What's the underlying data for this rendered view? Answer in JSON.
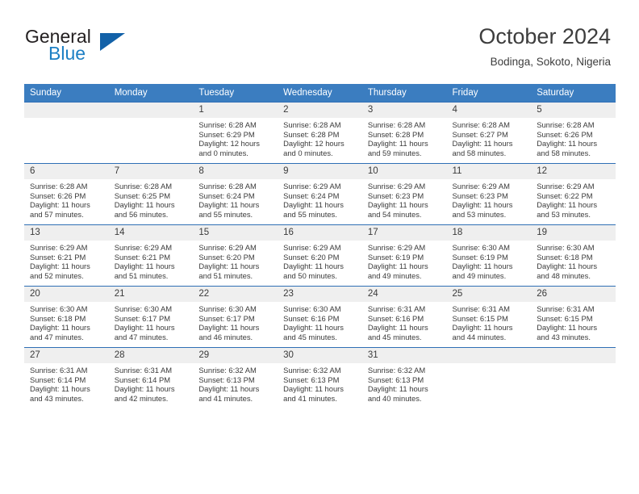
{
  "brand": {
    "name_part1": "General",
    "name_part2": "Blue",
    "logo_icon": "triangle-logo-icon"
  },
  "header": {
    "month_title": "October 2024",
    "location": "Bodinga, Sokoto, Nigeria"
  },
  "colors": {
    "header_blue": "#3b7dc0",
    "row_border_blue": "#2f6fb5",
    "daynum_band": "#efefef",
    "brand_blue": "#1c7fc4",
    "logo_blue": "#1261a8"
  },
  "calendar": {
    "weekday_headers": [
      "Sunday",
      "Monday",
      "Tuesday",
      "Wednesday",
      "Thursday",
      "Friday",
      "Saturday"
    ],
    "labels": {
      "sunrise": "Sunrise:",
      "sunset": "Sunset:",
      "daylight": "Daylight:"
    },
    "weeks": [
      [
        {
          "day": "",
          "empty": true
        },
        {
          "day": "",
          "empty": true
        },
        {
          "day": "1",
          "sunrise": "Sunrise: 6:28 AM",
          "sunset": "Sunset: 6:29 PM",
          "daylight": "Daylight: 12 hours and 0 minutes."
        },
        {
          "day": "2",
          "sunrise": "Sunrise: 6:28 AM",
          "sunset": "Sunset: 6:28 PM",
          "daylight": "Daylight: 12 hours and 0 minutes."
        },
        {
          "day": "3",
          "sunrise": "Sunrise: 6:28 AM",
          "sunset": "Sunset: 6:28 PM",
          "daylight": "Daylight: 11 hours and 59 minutes."
        },
        {
          "day": "4",
          "sunrise": "Sunrise: 6:28 AM",
          "sunset": "Sunset: 6:27 PM",
          "daylight": "Daylight: 11 hours and 58 minutes."
        },
        {
          "day": "5",
          "sunrise": "Sunrise: 6:28 AM",
          "sunset": "Sunset: 6:26 PM",
          "daylight": "Daylight: 11 hours and 58 minutes."
        }
      ],
      [
        {
          "day": "6",
          "sunrise": "Sunrise: 6:28 AM",
          "sunset": "Sunset: 6:26 PM",
          "daylight": "Daylight: 11 hours and 57 minutes."
        },
        {
          "day": "7",
          "sunrise": "Sunrise: 6:28 AM",
          "sunset": "Sunset: 6:25 PM",
          "daylight": "Daylight: 11 hours and 56 minutes."
        },
        {
          "day": "8",
          "sunrise": "Sunrise: 6:28 AM",
          "sunset": "Sunset: 6:24 PM",
          "daylight": "Daylight: 11 hours and 55 minutes."
        },
        {
          "day": "9",
          "sunrise": "Sunrise: 6:29 AM",
          "sunset": "Sunset: 6:24 PM",
          "daylight": "Daylight: 11 hours and 55 minutes."
        },
        {
          "day": "10",
          "sunrise": "Sunrise: 6:29 AM",
          "sunset": "Sunset: 6:23 PM",
          "daylight": "Daylight: 11 hours and 54 minutes."
        },
        {
          "day": "11",
          "sunrise": "Sunrise: 6:29 AM",
          "sunset": "Sunset: 6:23 PM",
          "daylight": "Daylight: 11 hours and 53 minutes."
        },
        {
          "day": "12",
          "sunrise": "Sunrise: 6:29 AM",
          "sunset": "Sunset: 6:22 PM",
          "daylight": "Daylight: 11 hours and 53 minutes."
        }
      ],
      [
        {
          "day": "13",
          "sunrise": "Sunrise: 6:29 AM",
          "sunset": "Sunset: 6:21 PM",
          "daylight": "Daylight: 11 hours and 52 minutes."
        },
        {
          "day": "14",
          "sunrise": "Sunrise: 6:29 AM",
          "sunset": "Sunset: 6:21 PM",
          "daylight": "Daylight: 11 hours and 51 minutes."
        },
        {
          "day": "15",
          "sunrise": "Sunrise: 6:29 AM",
          "sunset": "Sunset: 6:20 PM",
          "daylight": "Daylight: 11 hours and 51 minutes."
        },
        {
          "day": "16",
          "sunrise": "Sunrise: 6:29 AM",
          "sunset": "Sunset: 6:20 PM",
          "daylight": "Daylight: 11 hours and 50 minutes."
        },
        {
          "day": "17",
          "sunrise": "Sunrise: 6:29 AM",
          "sunset": "Sunset: 6:19 PM",
          "daylight": "Daylight: 11 hours and 49 minutes."
        },
        {
          "day": "18",
          "sunrise": "Sunrise: 6:30 AM",
          "sunset": "Sunset: 6:19 PM",
          "daylight": "Daylight: 11 hours and 49 minutes."
        },
        {
          "day": "19",
          "sunrise": "Sunrise: 6:30 AM",
          "sunset": "Sunset: 6:18 PM",
          "daylight": "Daylight: 11 hours and 48 minutes."
        }
      ],
      [
        {
          "day": "20",
          "sunrise": "Sunrise: 6:30 AM",
          "sunset": "Sunset: 6:18 PM",
          "daylight": "Daylight: 11 hours and 47 minutes."
        },
        {
          "day": "21",
          "sunrise": "Sunrise: 6:30 AM",
          "sunset": "Sunset: 6:17 PM",
          "daylight": "Daylight: 11 hours and 47 minutes."
        },
        {
          "day": "22",
          "sunrise": "Sunrise: 6:30 AM",
          "sunset": "Sunset: 6:17 PM",
          "daylight": "Daylight: 11 hours and 46 minutes."
        },
        {
          "day": "23",
          "sunrise": "Sunrise: 6:30 AM",
          "sunset": "Sunset: 6:16 PM",
          "daylight": "Daylight: 11 hours and 45 minutes."
        },
        {
          "day": "24",
          "sunrise": "Sunrise: 6:31 AM",
          "sunset": "Sunset: 6:16 PM",
          "daylight": "Daylight: 11 hours and 45 minutes."
        },
        {
          "day": "25",
          "sunrise": "Sunrise: 6:31 AM",
          "sunset": "Sunset: 6:15 PM",
          "daylight": "Daylight: 11 hours and 44 minutes."
        },
        {
          "day": "26",
          "sunrise": "Sunrise: 6:31 AM",
          "sunset": "Sunset: 6:15 PM",
          "daylight": "Daylight: 11 hours and 43 minutes."
        }
      ],
      [
        {
          "day": "27",
          "sunrise": "Sunrise: 6:31 AM",
          "sunset": "Sunset: 6:14 PM",
          "daylight": "Daylight: 11 hours and 43 minutes."
        },
        {
          "day": "28",
          "sunrise": "Sunrise: 6:31 AM",
          "sunset": "Sunset: 6:14 PM",
          "daylight": "Daylight: 11 hours and 42 minutes."
        },
        {
          "day": "29",
          "sunrise": "Sunrise: 6:32 AM",
          "sunset": "Sunset: 6:13 PM",
          "daylight": "Daylight: 11 hours and 41 minutes."
        },
        {
          "day": "30",
          "sunrise": "Sunrise: 6:32 AM",
          "sunset": "Sunset: 6:13 PM",
          "daylight": "Daylight: 11 hours and 41 minutes."
        },
        {
          "day": "31",
          "sunrise": "Sunrise: 6:32 AM",
          "sunset": "Sunset: 6:13 PM",
          "daylight": "Daylight: 11 hours and 40 minutes."
        },
        {
          "day": "",
          "empty": true
        },
        {
          "day": "",
          "empty": true
        }
      ]
    ]
  }
}
